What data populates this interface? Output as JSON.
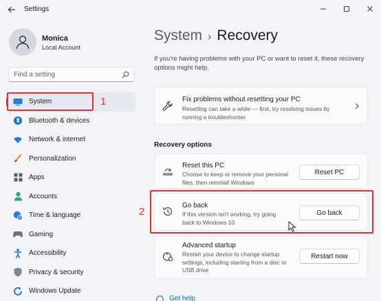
{
  "window": {
    "title": "Settings"
  },
  "profile": {
    "name": "Monica",
    "account_type": "Local Account"
  },
  "search": {
    "placeholder": "Find a setting"
  },
  "nav": {
    "items": [
      {
        "label": "System",
        "icon": "display-icon",
        "active": true
      },
      {
        "label": "Bluetooth & devices",
        "icon": "bluetooth-icon"
      },
      {
        "label": "Network & internet",
        "icon": "wifi-icon"
      },
      {
        "label": "Personalization",
        "icon": "brush-icon"
      },
      {
        "label": "Apps",
        "icon": "apps-icon"
      },
      {
        "label": "Accounts",
        "icon": "person-icon"
      },
      {
        "label": "Time & language",
        "icon": "globe-clock-icon"
      },
      {
        "label": "Gaming",
        "icon": "gamepad-icon"
      },
      {
        "label": "Accessibility",
        "icon": "accessibility-icon"
      },
      {
        "label": "Privacy & security",
        "icon": "shield-icon"
      },
      {
        "label": "Windows Update",
        "icon": "update-icon"
      }
    ]
  },
  "breadcrumb": {
    "parent": "System",
    "separator": "›",
    "current": "Recovery"
  },
  "intro": "If you're having problems with your PC or want to reset it, these recovery options might help.",
  "fix_card": {
    "title": "Fix problems without resetting your PC",
    "description": "Resetting can take a while — first, try resolving issues by running a troubleshooter"
  },
  "recovery_options": {
    "heading": "Recovery options",
    "items": [
      {
        "title": "Reset this PC",
        "description": "Choose to keep or remove your personal files, then reinstall Windows",
        "button": "Reset PC"
      },
      {
        "title": "Go back",
        "description": "If this version isn't working, try going back to Windows 10",
        "button": "Go back"
      },
      {
        "title": "Advanced startup",
        "description": "Restart your device to change startup settings, including starting from a disc or USB drive",
        "button": "Restart now"
      }
    ]
  },
  "help": {
    "label": "Get help"
  },
  "annotations": {
    "label_1": "1",
    "label_2": "2",
    "color": "#e03030"
  },
  "colors": {
    "accent": "#0067c0",
    "background": "#f2f4f8",
    "card": "#fbfbfc"
  }
}
